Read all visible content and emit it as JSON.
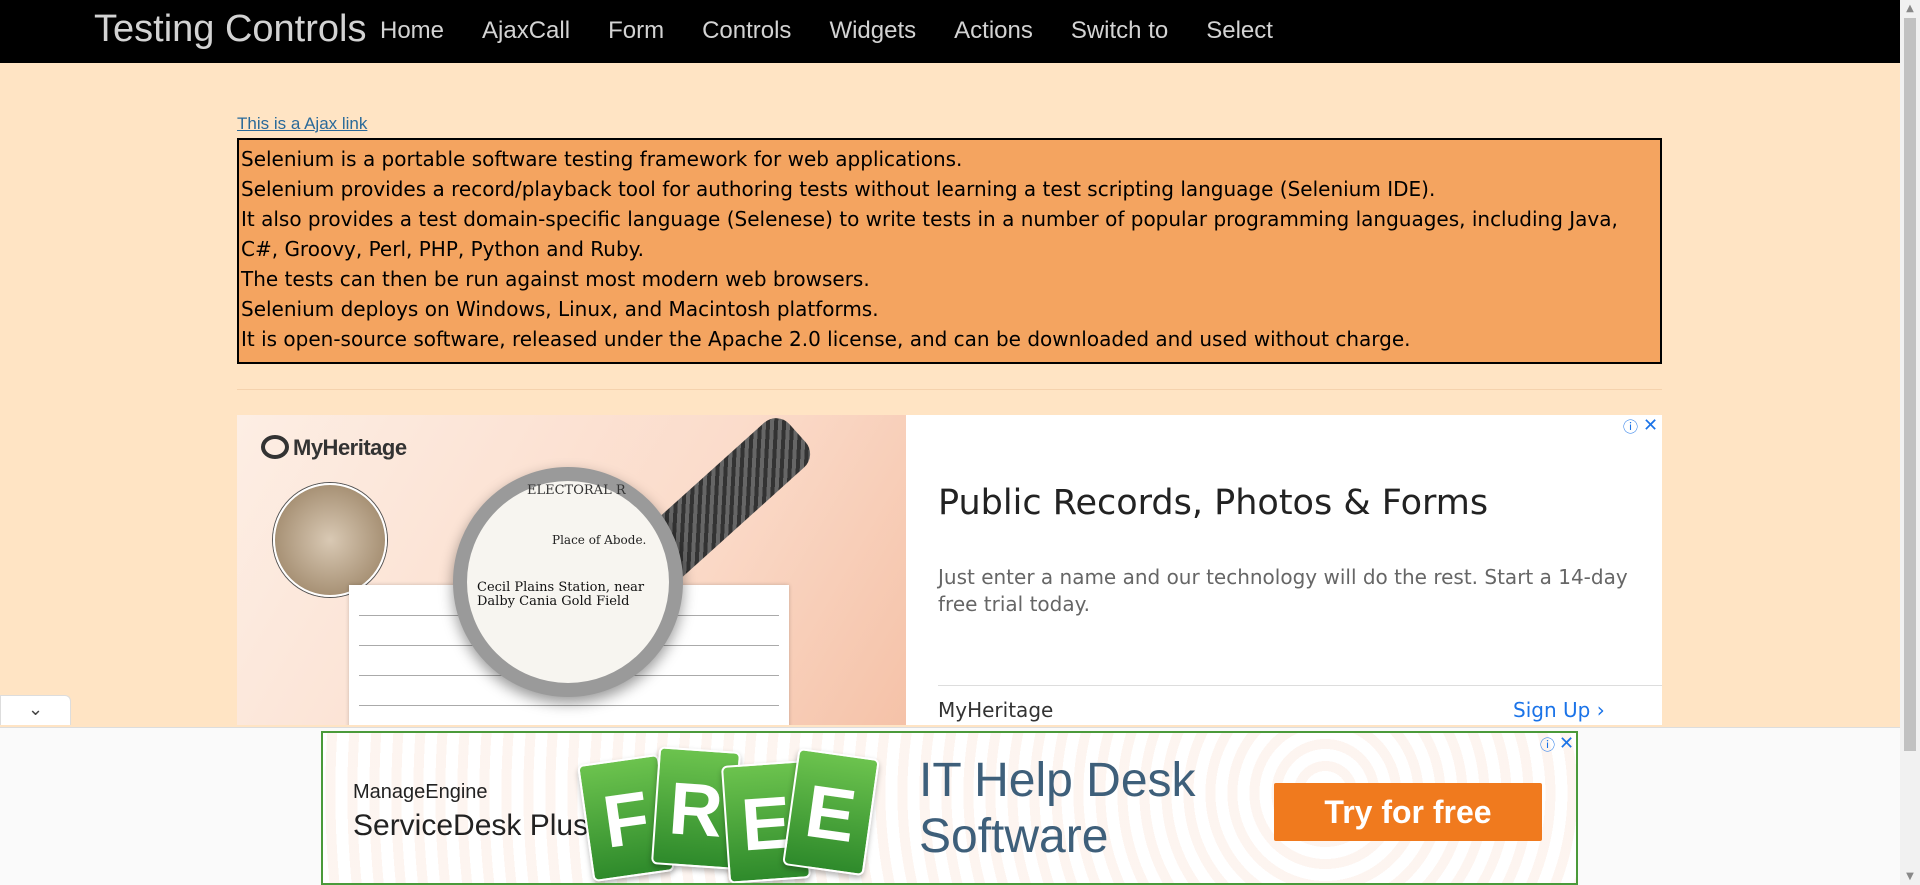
{
  "navbar": {
    "brand": "Testing Controls",
    "items": [
      "Home",
      "AjaxCall",
      "Form",
      "Controls",
      "Widgets",
      "Actions",
      "Switch to",
      "Select"
    ]
  },
  "content": {
    "ajax_link": "This is a Ajax link",
    "ajax_lines": [
      "Selenium is a portable software testing framework for web applications.",
      "Selenium provides a record/playback tool for authoring tests without learning a test scripting language (Selenium IDE).",
      "It also provides a test domain-specific language (Selenese) to write tests in a number of popular programming languages, including Java, C#, Groovy, Perl, PHP, Python and Ruby.",
      "The tests can then be run against most modern web browsers.",
      "Selenium deploys on Windows, Linux, and Macintosh platforms.",
      "It is open-source software, released under the Apache 2.0 license, and can be downloaded and used without charge."
    ]
  },
  "ad_top": {
    "logo": "MyHeritage",
    "image_text_header": "ELECTORAL R",
    "image_text_sub": "Place of Abode.",
    "image_text_main": "Cecil Plains Station, near Dalby Cania Gold Field",
    "title": "Public Records, Photos & Forms",
    "description": "Just enter a name and our technology will do the rest. Start a 14-day free trial today.",
    "brand": "MyHeritage",
    "cta": "Sign Up",
    "cta_icon": "chevron-right-icon",
    "info_icon": "ⓘ",
    "close_icon": "✕"
  },
  "collapse_tab": {
    "icon": "chevron-down-icon",
    "glyph": "⌄"
  },
  "ad_bottom": {
    "brand": "ManageEngine",
    "product": "ServiceDesk Plus",
    "tag_letters": [
      "F",
      "R",
      "E",
      "E"
    ],
    "headline_line1": "IT Help Desk",
    "headline_line2": "Software",
    "cta": "Try for free",
    "info_icon": "ⓘ",
    "close_icon": "✕",
    "border_color": "#4a9a3a",
    "cta_color": "#f07a1e"
  },
  "colors": {
    "page_background": "#ffe4c4",
    "navbar_background": "#000000",
    "ajax_box_background": "#f4a460"
  }
}
